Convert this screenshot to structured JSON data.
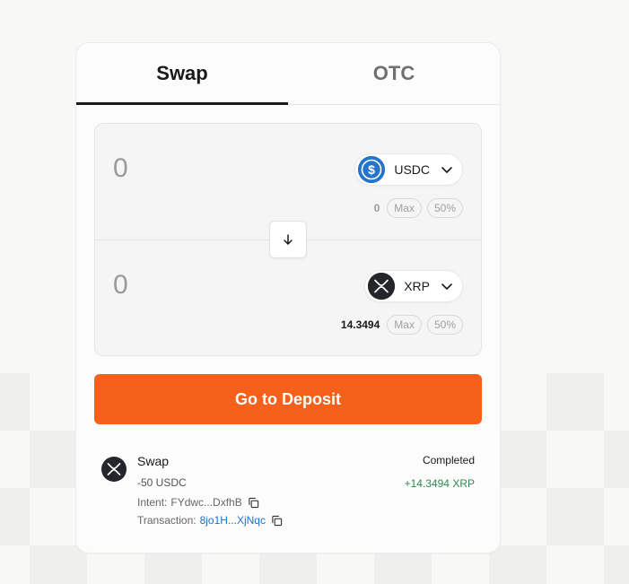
{
  "tabs": [
    {
      "label": "Swap",
      "active": true
    },
    {
      "label": "OTC",
      "active": false
    }
  ],
  "from": {
    "amount_placeholder": "0",
    "token": "USDC",
    "token_icon": "usdc-icon",
    "balance": "0",
    "max_label": "Max",
    "half_label": "50%"
  },
  "to": {
    "amount_placeholder": "0",
    "token": "XRP",
    "token_icon": "xrp-icon",
    "balance": "14.3494",
    "max_label": "Max",
    "half_label": "50%"
  },
  "deposit_button": "Go to Deposit",
  "transaction": {
    "title": "Swap",
    "sent": "-50 USDC",
    "intent_label": "Intent:",
    "intent_value": "FYdwc...DxfhB",
    "tx_label": "Transaction:",
    "tx_value": "8jo1H...XjNqc",
    "status": "Completed",
    "received": "+14.3494 XRP"
  },
  "colors": {
    "accent": "#f5601a",
    "success": "#2f8a4f",
    "link": "#1f6fd1",
    "usdc": "#2775ca",
    "xrp": "#23272b"
  }
}
